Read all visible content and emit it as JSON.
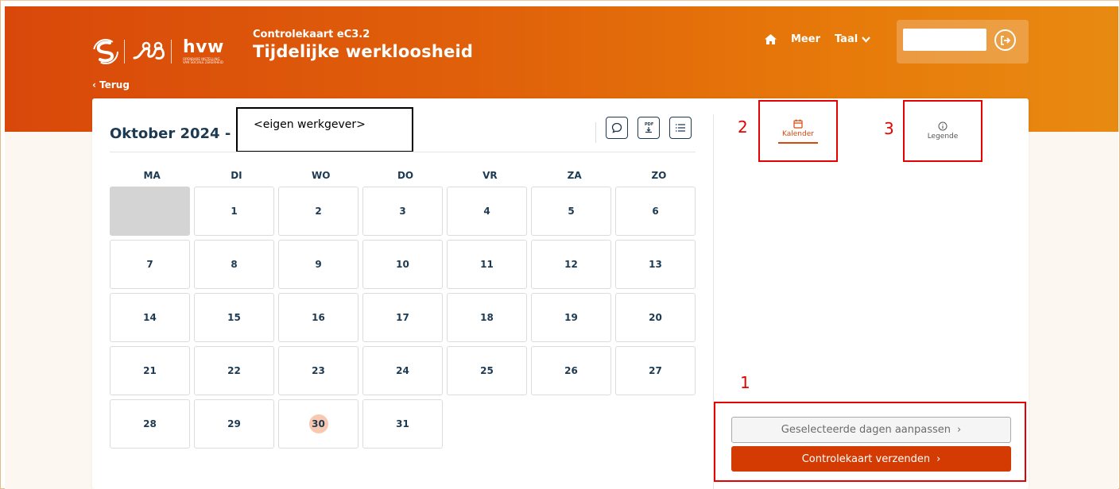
{
  "header": {
    "subtitle": "Controlekaart eC3.2",
    "title": "Tijdelijke werkloosheid",
    "back_label": "Terug",
    "logo_rva_text": "RVA",
    "logo_hvw_text": "hvw",
    "logo_hvw_small": "OPENBARE INSTELLING VAN SOCIALE ZEKERHEID",
    "nav": {
      "meer": "Meer",
      "taal": "Taal"
    },
    "login_value": ""
  },
  "calendar": {
    "month_title": "Oktober 2024 -",
    "employer": "<eigen werkgever>",
    "weekdays": [
      "MA",
      "DI",
      "WO",
      "DO",
      "VR",
      "ZA",
      "ZO"
    ],
    "weeks": [
      [
        "",
        "1",
        "2",
        "3",
        "4",
        "5",
        "6"
      ],
      [
        "7",
        "8",
        "9",
        "10",
        "11",
        "12",
        "13"
      ],
      [
        "14",
        "15",
        "16",
        "17",
        "18",
        "19",
        "20"
      ],
      [
        "21",
        "22",
        "23",
        "24",
        "25",
        "26",
        "27"
      ],
      [
        "28",
        "29",
        "30",
        "31"
      ]
    ],
    "today": "30",
    "tools": [
      "chat-icon",
      "pdf-download-icon",
      "list-icon"
    ]
  },
  "tabs": {
    "kalender": "Kalender",
    "legende": "Legende"
  },
  "annotations": {
    "n1": "1",
    "n2": "2",
    "n3": "3"
  },
  "actions": {
    "adjust": "Geselecteerde dagen aanpassen",
    "send": "Controlekaart verzenden"
  },
  "colors": {
    "brand_orange": "#d9480a",
    "navy": "#1d3a53",
    "annotation_red": "#e60000",
    "today_highlight": "#f8c8b0"
  }
}
